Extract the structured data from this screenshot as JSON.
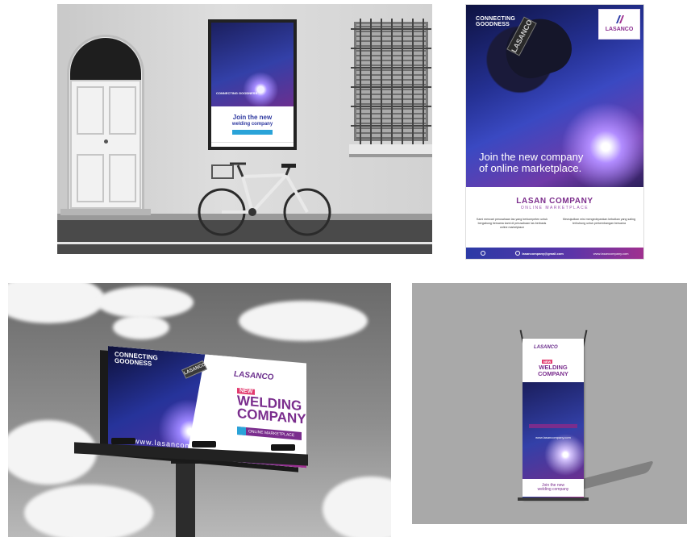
{
  "wall_poster": {
    "tagline": "CONNECTING GOODNESS",
    "headline": "Join the new",
    "subhead": "welding company"
  },
  "poster": {
    "tagline_line1": "CONNECTING",
    "tagline_line2": "GOODNESS",
    "badge": "LASANCO",
    "logo": "LASANCO",
    "headline_line1": "Join the new company",
    "headline_line2": "of online marketplace.",
    "company": "LASAN COMPANY",
    "company_sub": "ONLINE MARKETPLACE",
    "copy_left": "Kami mencari perusahaan las yang berkompeten untuk bergabung bersama kami di perusahaan las berbasis online marketplace",
    "copy_right": "Mewujudkan misi mengedepankan kebaikan yang saling terhubung untuk perkembangan bersama",
    "footer_email": "lasancompany@gmail.com",
    "footer_web": "www.lasancompany.com"
  },
  "billboard": {
    "tagline_line1": "CONNECTING",
    "tagline_line2": "GOODNESS",
    "badge": "LASANCO",
    "url": "www.lasancompany.com",
    "logo": "LASANCO",
    "new_label": "NEW",
    "headline_line1": "WELDING",
    "headline_line2": "COMPANY",
    "search_label": "ONLINE MARKETPLACE"
  },
  "xbanner": {
    "logo": "LASANCO",
    "new_label": "NEW",
    "headline_line1": "WELDING",
    "headline_line2": "COMPANY",
    "url": "www.lasancompany.com",
    "join_line1": "Join the new",
    "join_line2": "welding company"
  },
  "colors": {
    "brand_purple": "#7a2d8d",
    "brand_blue": "#2b3aa6",
    "accent_pink": "#e23b6f",
    "accent_cyan": "#2aa3d8"
  }
}
